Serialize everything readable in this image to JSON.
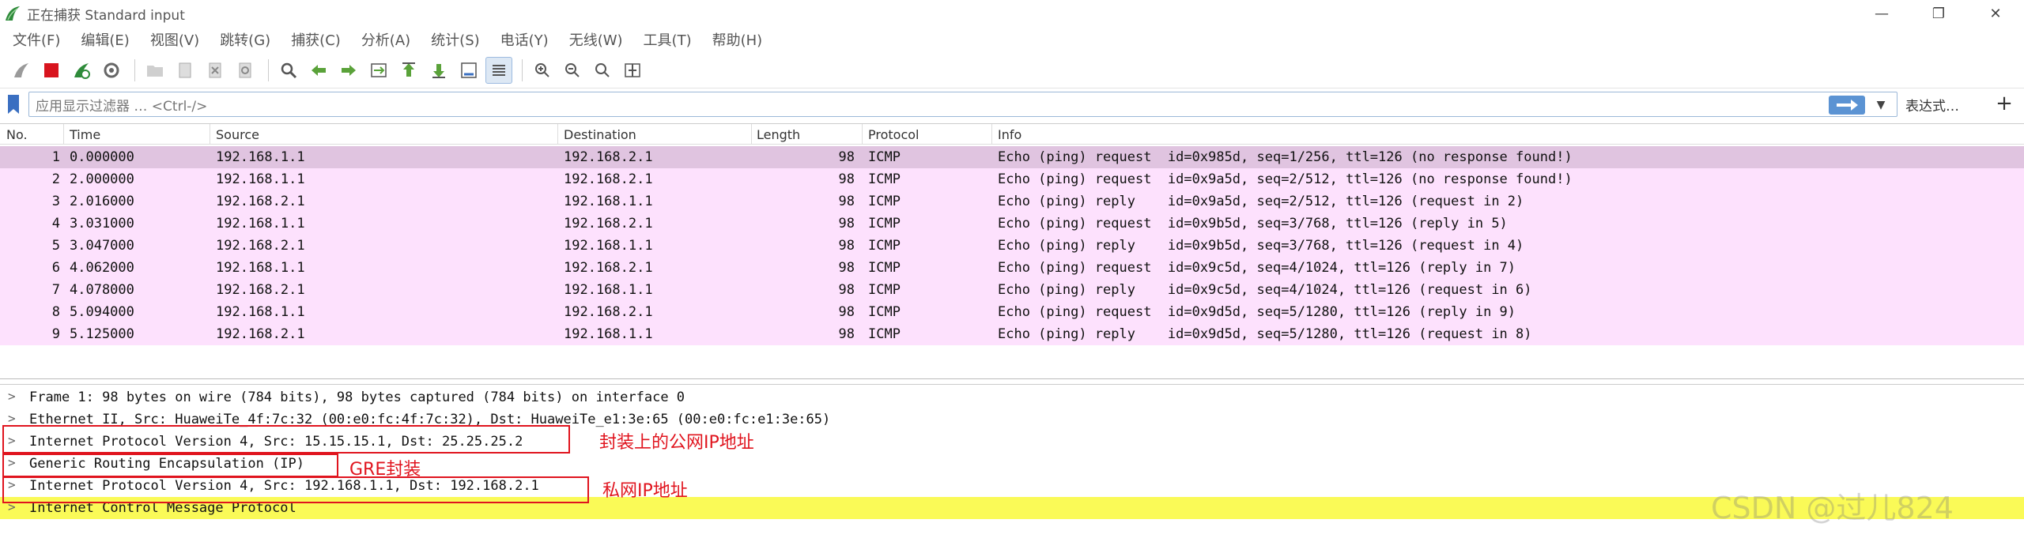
{
  "window": {
    "title": "正在捕获 Standard input"
  },
  "menu": [
    "文件(F)",
    "编辑(E)",
    "视图(V)",
    "跳转(G)",
    "捕获(C)",
    "分析(A)",
    "统计(S)",
    "电话(Y)",
    "无线(W)",
    "工具(T)",
    "帮助(H)"
  ],
  "filter": {
    "placeholder": "应用显示过滤器 … <Ctrl-/>",
    "expression_label": "表达式…"
  },
  "columns": [
    "No.",
    "Time",
    "Source",
    "Destination",
    "Length",
    "Protocol",
    "Info"
  ],
  "packets": [
    {
      "no": "1",
      "time": "0.000000",
      "src": "192.168.1.1",
      "dst": "192.168.2.1",
      "len": "98",
      "proto": "ICMP",
      "info": "Echo (ping) request  id=0x985d, seq=1/256, ttl=126 (no response found!)"
    },
    {
      "no": "2",
      "time": "2.000000",
      "src": "192.168.1.1",
      "dst": "192.168.2.1",
      "len": "98",
      "proto": "ICMP",
      "info": "Echo (ping) request  id=0x9a5d, seq=2/512, ttl=126 (no response found!)"
    },
    {
      "no": "3",
      "time": "2.016000",
      "src": "192.168.2.1",
      "dst": "192.168.1.1",
      "len": "98",
      "proto": "ICMP",
      "info": "Echo (ping) reply    id=0x9a5d, seq=2/512, ttl=126 (request in 2)"
    },
    {
      "no": "4",
      "time": "3.031000",
      "src": "192.168.1.1",
      "dst": "192.168.2.1",
      "len": "98",
      "proto": "ICMP",
      "info": "Echo (ping) request  id=0x9b5d, seq=3/768, ttl=126 (reply in 5)"
    },
    {
      "no": "5",
      "time": "3.047000",
      "src": "192.168.2.1",
      "dst": "192.168.1.1",
      "len": "98",
      "proto": "ICMP",
      "info": "Echo (ping) reply    id=0x9b5d, seq=3/768, ttl=126 (request in 4)"
    },
    {
      "no": "6",
      "time": "4.062000",
      "src": "192.168.1.1",
      "dst": "192.168.2.1",
      "len": "98",
      "proto": "ICMP",
      "info": "Echo (ping) request  id=0x9c5d, seq=4/1024, ttl=126 (reply in 7)"
    },
    {
      "no": "7",
      "time": "4.078000",
      "src": "192.168.2.1",
      "dst": "192.168.1.1",
      "len": "98",
      "proto": "ICMP",
      "info": "Echo (ping) reply    id=0x9c5d, seq=4/1024, ttl=126 (request in 6)"
    },
    {
      "no": "8",
      "time": "5.094000",
      "src": "192.168.1.1",
      "dst": "192.168.2.1",
      "len": "98",
      "proto": "ICMP",
      "info": "Echo (ping) request  id=0x9d5d, seq=5/1280, ttl=126 (reply in 9)"
    },
    {
      "no": "9",
      "time": "5.125000",
      "src": "192.168.2.1",
      "dst": "192.168.1.1",
      "len": "98",
      "proto": "ICMP",
      "info": "Echo (ping) reply    id=0x9d5d, seq=5/1280, ttl=126 (request in 8)"
    }
  ],
  "details": [
    "Frame 1: 98 bytes on wire (784 bits), 98 bytes captured (784 bits) on interface 0",
    "Ethernet II, Src: HuaweiTe_4f:7c:32 (00:e0:fc:4f:7c:32), Dst: HuaweiTe_e1:3e:65 (00:e0:fc:e1:3e:65)",
    "Internet Protocol Version 4, Src: 15.15.15.1, Dst: 25.25.25.2",
    "Generic Routing Encapsulation (IP)",
    "Internet Protocol Version 4, Src: 192.168.1.1, Dst: 192.168.2.1",
    "Internet Control Message Protocol"
  ],
  "annotations": [
    "封装上的公网IP地址",
    "GRE封装",
    "私网IP地址"
  ],
  "watermark": "CSDN @过儿824",
  "colors": {
    "row_bg": "#fde1fd",
    "row_selected": "#e0c4e0",
    "highlight": "#fafa57",
    "annotation": "#e0141e"
  }
}
